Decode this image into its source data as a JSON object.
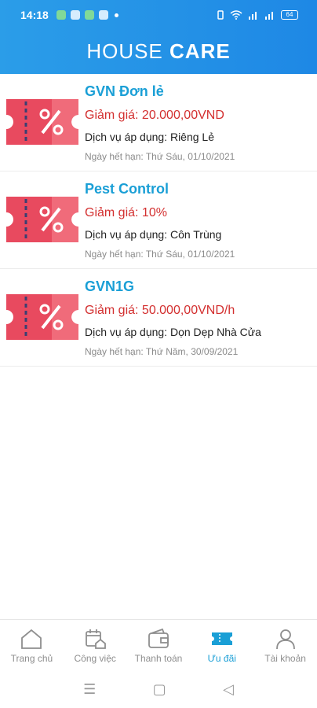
{
  "status_bar": {
    "time": "14:18",
    "battery": "64"
  },
  "app": {
    "title_light": "HOUSE",
    "title_bold": "CARE"
  },
  "coupons": [
    {
      "title": "GVN Đơn lẻ",
      "discount": "Giảm giá: 20.000,00VND",
      "service": "Dịch vụ áp dụng: Riêng Lẻ",
      "expiry": "Ngày hết hạn: Thứ Sáu, 01/10/2021"
    },
    {
      "title": "Pest Control",
      "discount": "Giảm giá: 10%",
      "service": "Dịch vụ áp dụng: Côn Trùng",
      "expiry": "Ngày hết hạn: Thứ Sáu, 01/10/2021"
    },
    {
      "title": "GVN1G",
      "discount": "Giảm giá: 50.000,00VND/h",
      "service": "Dịch vụ áp dụng: Dọn Dẹp Nhà Cửa",
      "expiry": "Ngày hết hạn: Thứ Năm, 30/09/2021"
    }
  ],
  "nav": [
    {
      "label": "Trang chủ",
      "icon": "home-icon"
    },
    {
      "label": "Công việc",
      "icon": "calendar-home-icon"
    },
    {
      "label": "Thanh toán",
      "icon": "wallet-icon"
    },
    {
      "label": "Ưu đãi",
      "icon": "ticket-icon",
      "active": true
    },
    {
      "label": "Tài khoản",
      "icon": "user-icon"
    }
  ],
  "colors": {
    "header": "#1e88e5",
    "accent": "#1a9fd6",
    "discount": "#d32f2f",
    "coupon": "#e84a5f"
  }
}
